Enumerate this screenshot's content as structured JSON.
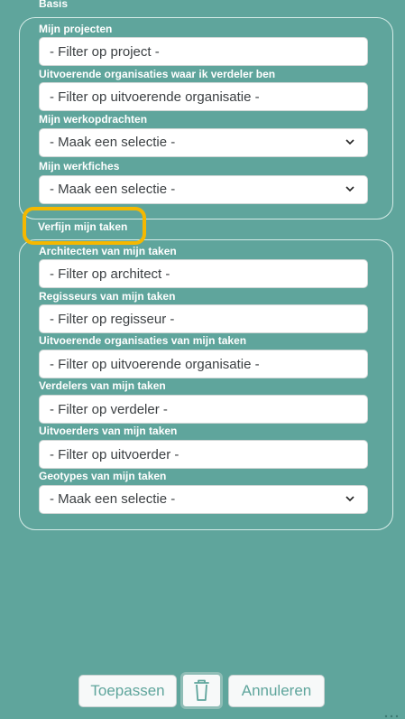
{
  "sections": {
    "basis_title": "Basis",
    "refine_title": "Verfijn mijn taken"
  },
  "basis": {
    "projects_label": "Mijn projecten",
    "projects_placeholder": "- Filter op project -",
    "orgs_distributor_label": "Uitvoerende organisaties waar ik verdeler ben",
    "orgs_distributor_placeholder": "- Filter op uitvoerende organisatie -",
    "work_orders_label": "Mijn werkopdrachten",
    "work_orders_value": "- Maak een selectie -",
    "work_sheets_label": "Mijn werkfiches",
    "work_sheets_value": "- Maak een selectie -"
  },
  "refine": {
    "architects_label": "Architecten van mijn taken",
    "architects_placeholder": "- Filter op architect -",
    "directors_label": "Regisseurs van mijn taken",
    "directors_placeholder": "- Filter op regisseur -",
    "orgs_label": "Uitvoerende organisaties van mijn taken",
    "orgs_placeholder": "- Filter op uitvoerende organisatie -",
    "distributors_label": "Verdelers van mijn taken",
    "distributors_placeholder": "- Filter op verdeler -",
    "executors_label": "Uitvoerders van mijn taken",
    "executors_placeholder": "- Filter op uitvoerder -",
    "geotypes_label": "Geotypes van mijn taken",
    "geotypes_value": "- Maak een selectie -"
  },
  "footer": {
    "apply_label": "Toepassen",
    "cancel_label": "Annuleren",
    "trash_icon": "trash-icon"
  },
  "colors": {
    "panel": "#5fa59c",
    "highlight": "#f5b800"
  }
}
